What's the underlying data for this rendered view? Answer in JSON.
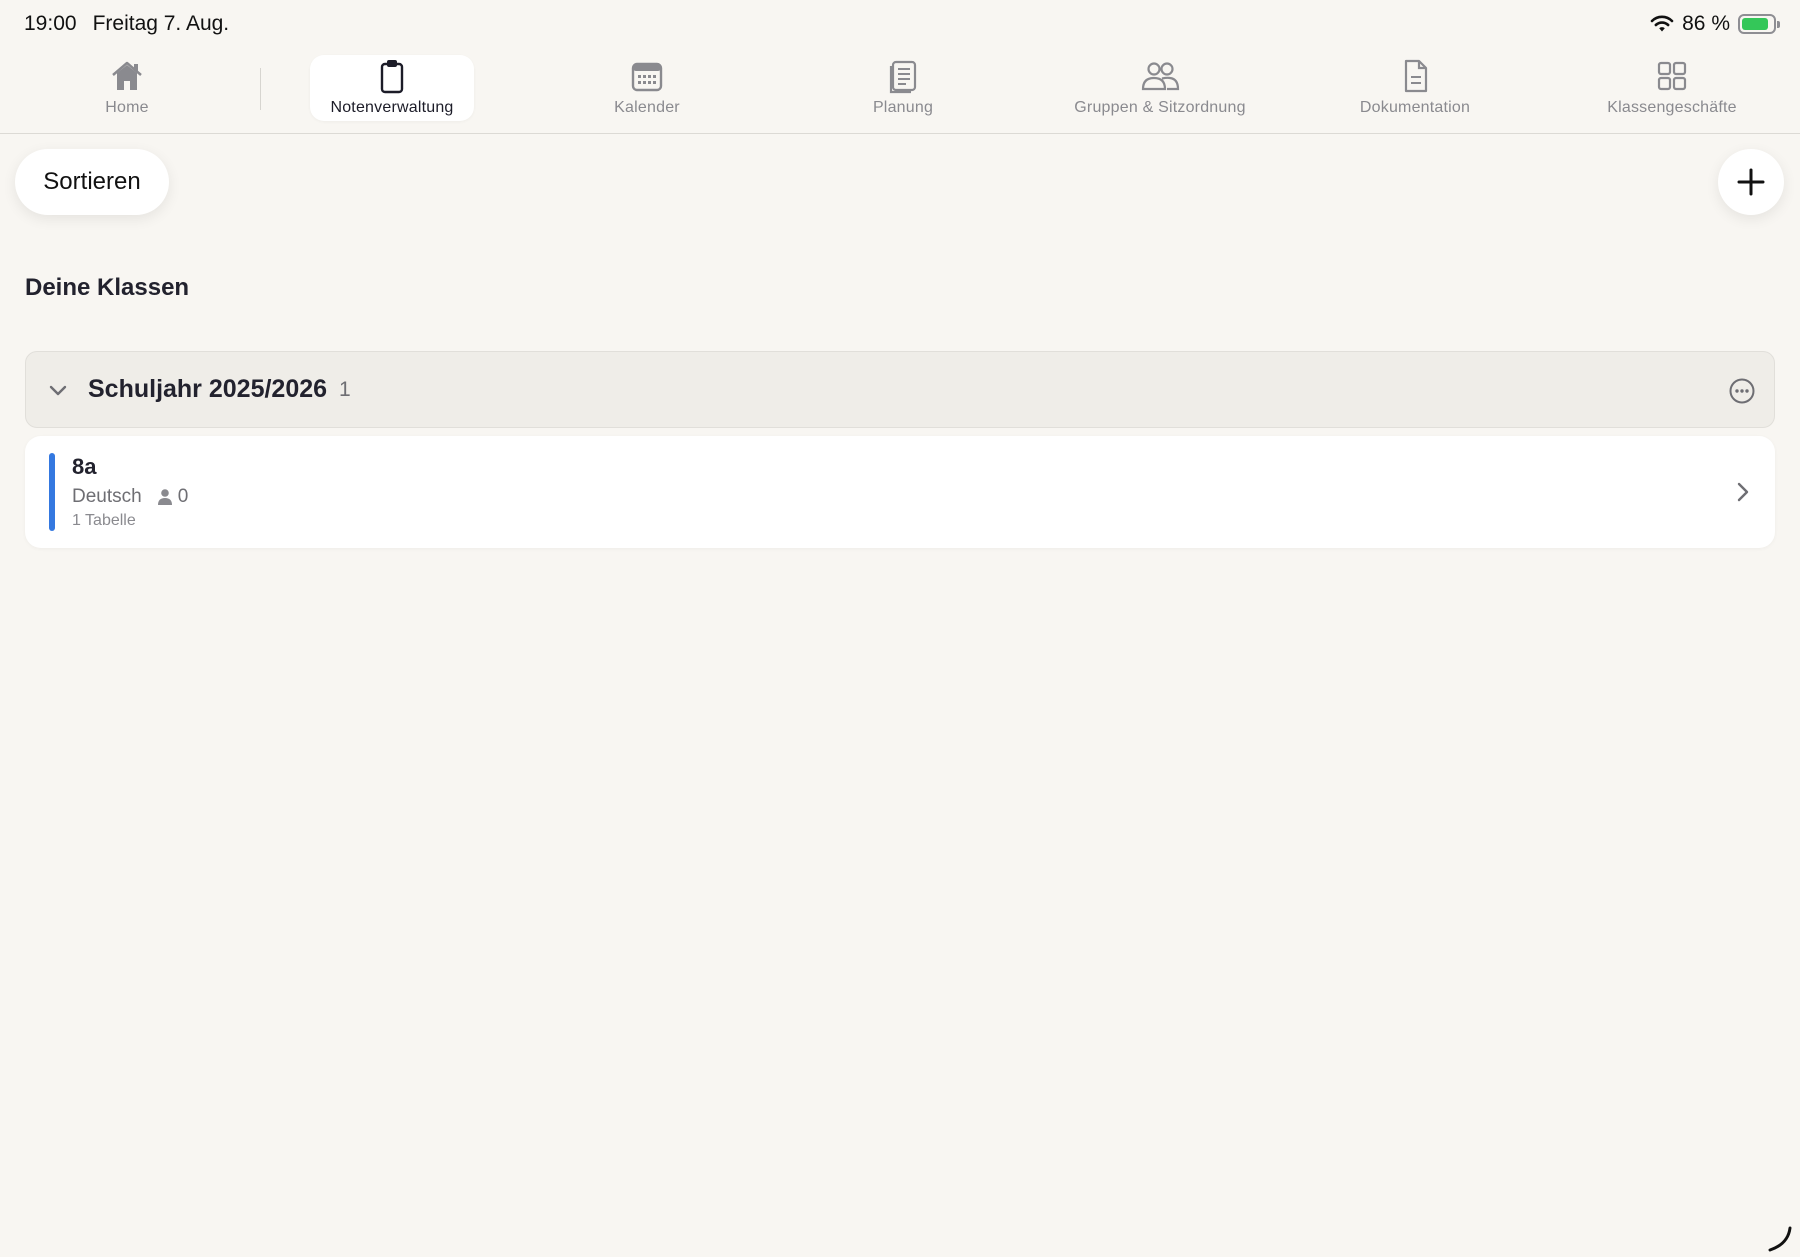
{
  "status_bar": {
    "time": "19:00",
    "date": "Freitag 7. Aug.",
    "battery": "86 %",
    "battery_level": 0.86,
    "wifi_icon": "wifi-icon",
    "battery_icon": "battery-charging-icon"
  },
  "tabs": [
    {
      "label": "Home",
      "icon": "house-icon",
      "active": false
    },
    {
      "label": "Notenverwaltung",
      "icon": "clipboard-icon",
      "active": true
    },
    {
      "label": "Kalender",
      "icon": "calendar-icon",
      "active": false
    },
    {
      "label": "Planung",
      "icon": "document-stack-icon",
      "active": false
    },
    {
      "label": "Gruppen & Sitzordnung",
      "icon": "people-icon",
      "active": false
    },
    {
      "label": "Dokumentation",
      "icon": "document-icon",
      "active": false
    },
    {
      "label": "Klassengeschäfte",
      "icon": "grid-icon",
      "active": false
    }
  ],
  "toolbar": {
    "sort_label": "Sortieren",
    "add_icon": "plus-icon"
  },
  "section_title": "Deine Klassen",
  "groups": [
    {
      "title": "Schuljahr 2025/2026",
      "count": "1",
      "classes": [
        {
          "name": "8a",
          "subject": "Deutsch",
          "students": "0",
          "tables": "1 Tabelle",
          "accent_color": "#3478e0"
        }
      ]
    }
  ],
  "colors": {
    "background": "#f8f6f2",
    "accent": "#3478e0",
    "inactive_tab": "#8a8a8f",
    "battery_green": "#34c759"
  }
}
